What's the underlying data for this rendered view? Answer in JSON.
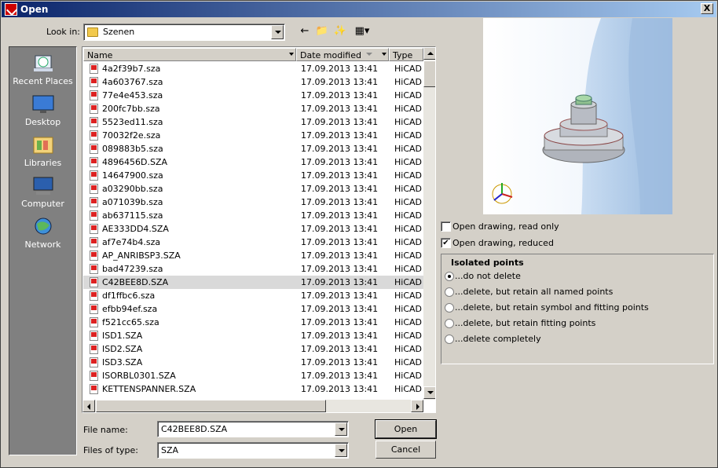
{
  "window": {
    "title": "Open",
    "close_label": "X"
  },
  "lookin": {
    "label": "Look in:",
    "value": "Szenen"
  },
  "places": [
    {
      "label": "Recent Places",
      "icon": "recent-places-icon"
    },
    {
      "label": "Desktop",
      "icon": "desktop-icon"
    },
    {
      "label": "Libraries",
      "icon": "libraries-icon"
    },
    {
      "label": "Computer",
      "icon": "computer-icon"
    },
    {
      "label": "Network",
      "icon": "network-icon"
    }
  ],
  "columns": {
    "name": "Name",
    "date": "Date modified",
    "type": "Type"
  },
  "files": [
    {
      "name": "4a2f39b7.sza",
      "date": "17.09.2013 13:41",
      "type": "HiCAD D"
    },
    {
      "name": "4a603767.sza",
      "date": "17.09.2013 13:41",
      "type": "HiCAD D"
    },
    {
      "name": "77e4e453.sza",
      "date": "17.09.2013 13:41",
      "type": "HiCAD D"
    },
    {
      "name": "200fc7bb.sza",
      "date": "17.09.2013 13:41",
      "type": "HiCAD D"
    },
    {
      "name": "5523ed11.sza",
      "date": "17.09.2013 13:41",
      "type": "HiCAD D"
    },
    {
      "name": "70032f2e.sza",
      "date": "17.09.2013 13:41",
      "type": "HiCAD D"
    },
    {
      "name": "089883b5.sza",
      "date": "17.09.2013 13:41",
      "type": "HiCAD D"
    },
    {
      "name": "4896456D.SZA",
      "date": "17.09.2013 13:41",
      "type": "HiCAD D"
    },
    {
      "name": "14647900.sza",
      "date": "17.09.2013 13:41",
      "type": "HiCAD D"
    },
    {
      "name": "a03290bb.sza",
      "date": "17.09.2013 13:41",
      "type": "HiCAD D"
    },
    {
      "name": "a071039b.sza",
      "date": "17.09.2013 13:41",
      "type": "HiCAD D"
    },
    {
      "name": "ab637115.sza",
      "date": "17.09.2013 13:41",
      "type": "HiCAD D"
    },
    {
      "name": "AE333DD4.SZA",
      "date": "17.09.2013 13:41",
      "type": "HiCAD D"
    },
    {
      "name": "af7e74b4.sza",
      "date": "17.09.2013 13:41",
      "type": "HiCAD D"
    },
    {
      "name": "AP_ANRIBSP3.SZA",
      "date": "17.09.2013 13:41",
      "type": "HiCAD D"
    },
    {
      "name": "bad47239.sza",
      "date": "17.09.2013 13:41",
      "type": "HiCAD D"
    },
    {
      "name": "C42BEE8D.SZA",
      "date": "17.09.2013 13:41",
      "type": "HiCAD D",
      "selected": true
    },
    {
      "name": "df1ffbc6.sza",
      "date": "17.09.2013 13:41",
      "type": "HiCAD D"
    },
    {
      "name": "efbb94ef.sza",
      "date": "17.09.2013 13:41",
      "type": "HiCAD D"
    },
    {
      "name": "f521cc65.sza",
      "date": "17.09.2013 13:41",
      "type": "HiCAD D"
    },
    {
      "name": "ISD1.SZA",
      "date": "17.09.2013 13:41",
      "type": "HiCAD D"
    },
    {
      "name": "ISD2.SZA",
      "date": "17.09.2013 13:41",
      "type": "HiCAD D"
    },
    {
      "name": "ISD3.SZA",
      "date": "17.09.2013 13:41",
      "type": "HiCAD D"
    },
    {
      "name": "ISORBL0301.SZA",
      "date": "17.09.2013 13:41",
      "type": "HiCAD D"
    },
    {
      "name": "KETTENSPANNER.SZA",
      "date": "17.09.2013 13:41",
      "type": "HiCAD D"
    }
  ],
  "filename": {
    "label": "File name:",
    "value": "C42BEE8D.SZA"
  },
  "filetype": {
    "label": "Files of type:",
    "value": "SZA"
  },
  "buttons": {
    "open": "Open",
    "cancel": "Cancel"
  },
  "options": {
    "read_only": {
      "label": "Open drawing, read only",
      "checked": false,
      "mark": ""
    },
    "reduced": {
      "label": "Open drawing, reduced",
      "checked": true,
      "mark": "✔"
    }
  },
  "isolated_points": {
    "title": "Isolated points",
    "choices": [
      {
        "label": "...do not delete",
        "selected": true
      },
      {
        "label": "...delete, but retain all named points",
        "selected": false
      },
      {
        "label": "...delete, but retain symbol and fitting points",
        "selected": false
      },
      {
        "label": "...delete, but retain fitting points",
        "selected": false
      },
      {
        "label": "...delete completely",
        "selected": false
      }
    ]
  }
}
